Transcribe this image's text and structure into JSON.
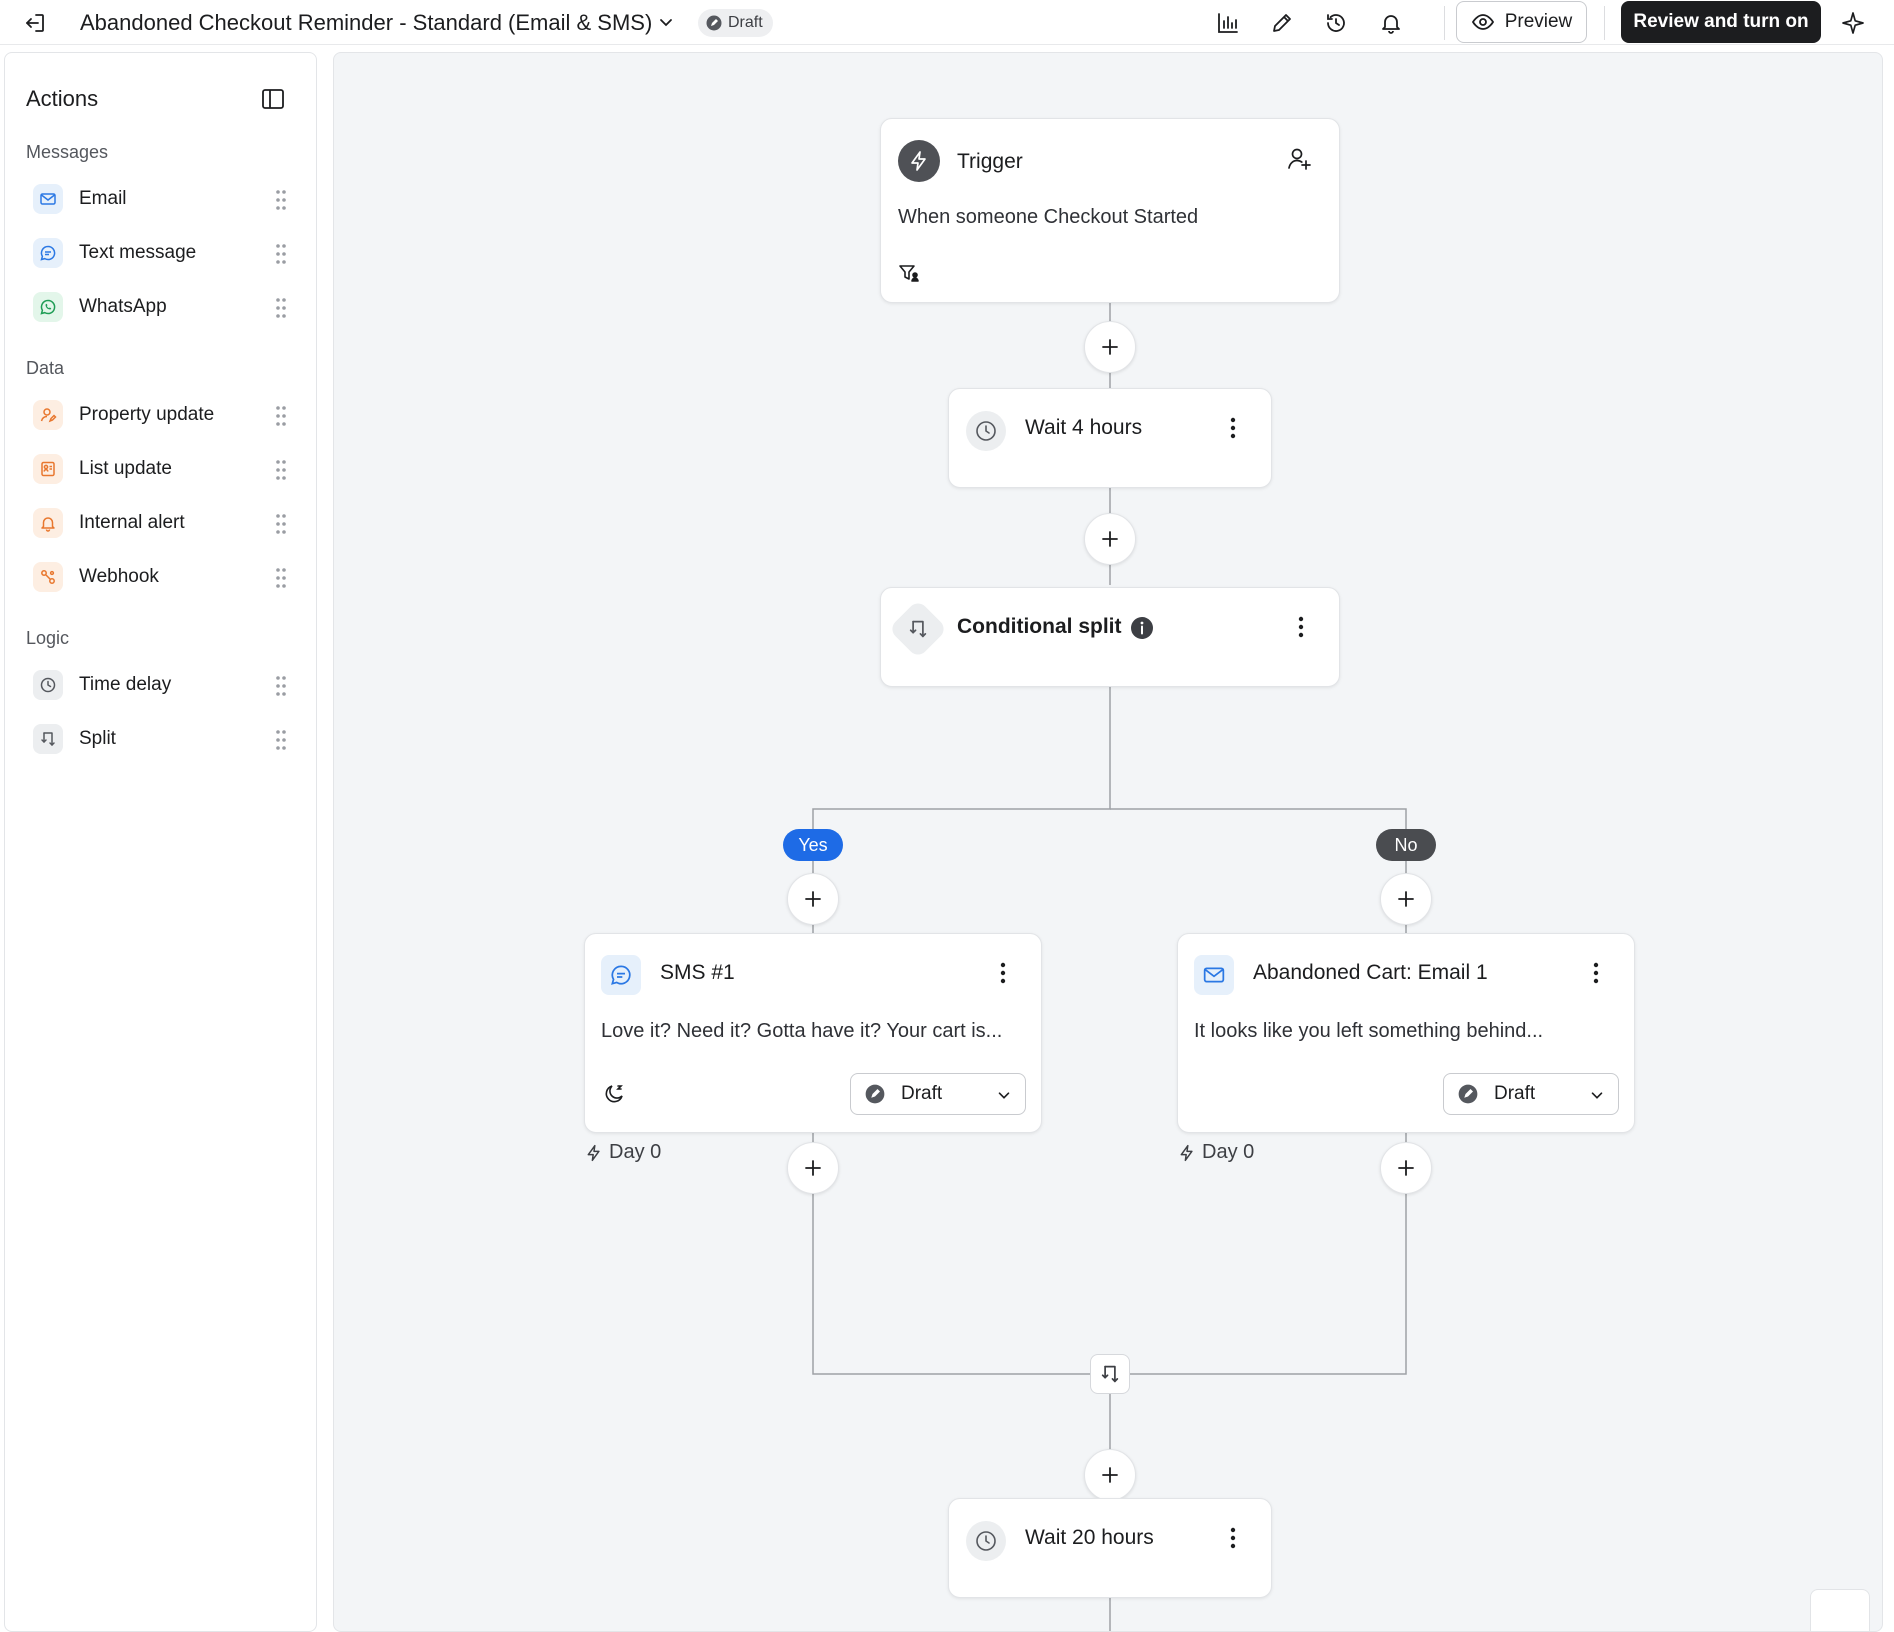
{
  "header": {
    "title": "Abandoned Checkout Reminder - Standard (Email & SMS)",
    "status": "Draft",
    "preview_label": "Preview",
    "review_label": "Review and turn on",
    "icons": [
      "back-icon",
      "chevron-down-icon",
      "analytics-icon",
      "edit-icon",
      "history-icon",
      "notifications-icon",
      "eye-icon",
      "sparkle-icon"
    ]
  },
  "sidebar": {
    "title": "Actions",
    "sections": [
      {
        "label": "Messages",
        "items": [
          {
            "label": "Email",
            "icon": "email-icon"
          },
          {
            "label": "Text message",
            "icon": "text-message-icon"
          },
          {
            "label": "WhatsApp",
            "icon": "whatsapp-icon"
          }
        ]
      },
      {
        "label": "Data",
        "items": [
          {
            "label": "Property update",
            "icon": "property-update-icon"
          },
          {
            "label": "List update",
            "icon": "list-update-icon"
          },
          {
            "label": "Internal alert",
            "icon": "bell-icon"
          },
          {
            "label": "Webhook",
            "icon": "webhook-icon"
          }
        ]
      },
      {
        "label": "Logic",
        "items": [
          {
            "label": "Time delay",
            "icon": "clock-icon"
          },
          {
            "label": "Split",
            "icon": "split-icon"
          }
        ]
      }
    ]
  },
  "flow": {
    "trigger": {
      "title": "Trigger",
      "description": "When someone Checkout Started"
    },
    "wait1": {
      "title": "Wait 4 hours"
    },
    "split": {
      "title": "Conditional split"
    },
    "branches": {
      "yes": "Yes",
      "no": "No"
    },
    "sms": {
      "title": "SMS #1",
      "text": "Love it? Need it? Gotta have it? Your cart is...",
      "status": "Draft",
      "day": "Day 0"
    },
    "email": {
      "title": "Abandoned Cart: Email 1",
      "text": "It looks like you left something behind...",
      "status": "Draft",
      "day": "Day 0"
    },
    "wait2": {
      "title": "Wait 20 hours"
    }
  },
  "colors": {
    "accent_blue": "#1e6be6",
    "branch_no": "#4a4c50",
    "primary_button": "#1c1d1f"
  }
}
